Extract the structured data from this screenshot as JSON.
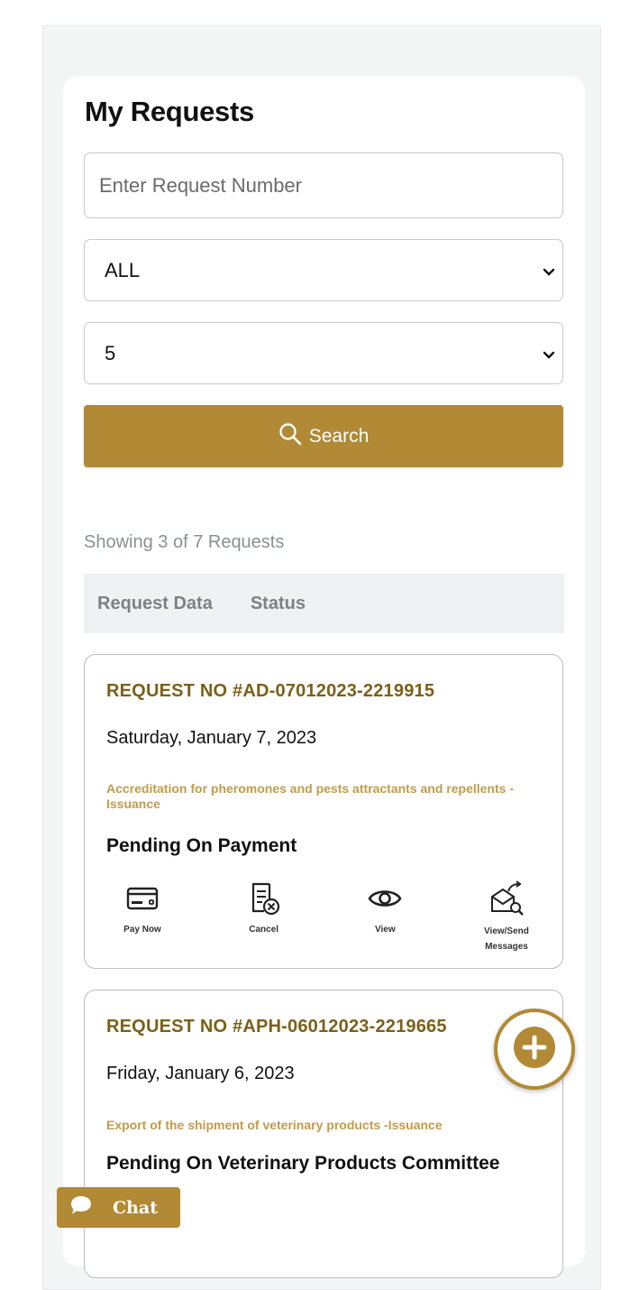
{
  "header": {
    "title": "My Requests"
  },
  "filters": {
    "request_number_placeholder": "Enter Request Number",
    "status_selected": "ALL",
    "page_size_selected": "5",
    "search_label": "Search"
  },
  "list": {
    "showing_text": "Showing 3 of 7 Requests",
    "columns": [
      "Request Data",
      "Status"
    ]
  },
  "requests": [
    {
      "number": "REQUEST NO #AD-07012023-2219915",
      "date": "Saturday, January 7, 2023",
      "service": "Accreditation for pheromones and pests attractants and repellents -Issuance",
      "status": "Pending On Payment",
      "actions": [
        "Pay Now",
        "Cancel",
        "View",
        "View/Send Messages"
      ]
    },
    {
      "number": "REQUEST NO #APH-06012023-2219665",
      "date": "Friday, January 6, 2023",
      "service": "Export of the shipment of veterinary products -Issuance",
      "status": "Pending On Veterinary Products Committee"
    }
  ],
  "chat": {
    "label": "Chat"
  },
  "colors": {
    "accent": "#b28934",
    "request_number": "#7b6019",
    "service_text": "#c29b4b"
  },
  "icons": [
    "search-icon",
    "chevron-down-icon",
    "credit-card-icon",
    "cancel-document-icon",
    "eye-icon",
    "messages-icon",
    "plus-circle-icon",
    "chat-bubble-icon"
  ]
}
